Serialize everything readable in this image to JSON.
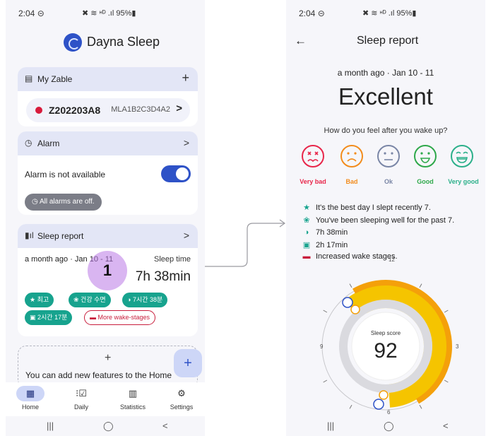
{
  "left": {
    "status": {
      "time": "2:04 ⊝",
      "icons": "✖ ≋ ᵸᴰ .ıl 95%▮"
    },
    "app_title": "Dayna Sleep",
    "zable": {
      "title": "My Zable",
      "add": "+",
      "device_id": "Z202203A8",
      "device_mac": "MLA1B2C3D4A2",
      "chevron": ">"
    },
    "alarm": {
      "title": "Alarm",
      "chevron": ">",
      "status": "Alarm is not available",
      "chip": "All alarms are off."
    },
    "sleep_report": {
      "title": "Sleep report",
      "chevron": ">",
      "when": "a month ago · Jan 10 - 11",
      "time_label": "Sleep time",
      "time_value": "7h 38min",
      "tags": [
        "최고",
        "건강 수면",
        "7시간 38분",
        "2시간 17분",
        "More wake-stages"
      ]
    },
    "touch_marker": "1",
    "add_feature": {
      "plus": "+",
      "text": "You can add new features to the Home"
    },
    "fab": "+",
    "nav": [
      {
        "label": "Home",
        "icon": "home-icon"
      },
      {
        "label": "Daily",
        "icon": "checklist-icon"
      },
      {
        "label": "Statistics",
        "icon": "chart-icon"
      },
      {
        "label": "Settings",
        "icon": "gear-icon"
      }
    ],
    "sysnav": {
      "recent": "|||",
      "home": "◯",
      "back": "<"
    }
  },
  "right": {
    "status": {
      "time": "2:04 ⊝",
      "icons": "✖ ≋ ᵸᴰ .ıl 95%▮"
    },
    "back": "←",
    "title": "Sleep report",
    "when": "a month ago · Jan 10 - 11",
    "rating": "Excellent",
    "question": "How do you feel after you wake up?",
    "moods": [
      {
        "label": "Very bad",
        "color": "#e8264a"
      },
      {
        "label": "Bad",
        "color": "#f28c1c"
      },
      {
        "label": "Ok",
        "color": "#7a86a6"
      },
      {
        "label": "Good",
        "color": "#2ea84a"
      },
      {
        "label": "Very good",
        "color": "#2cb08a"
      }
    ],
    "highlights": [
      {
        "text": "It's the best day I slept recently 7.",
        "icon": "star-icon"
      },
      {
        "text": "You've been sleeping well for the past 7.",
        "icon": "cluster-icon"
      },
      {
        "text": "7h 38min",
        "icon": "moon-icon"
      },
      {
        "text": "2h 17min",
        "icon": "zzz-icon"
      },
      {
        "text": "Increased wake stages.",
        "icon": "bed-icon"
      }
    ],
    "dial": {
      "labels": [
        "12",
        "3",
        "6",
        "9"
      ],
      "score_label": "Sleep score",
      "score": "92",
      "score_value": 92
    },
    "sysnav": {
      "recent": "|||",
      "home": "◯",
      "back": "<"
    }
  },
  "colors": {
    "primary": "#2e52c7",
    "teal": "#17a38e",
    "alert": "#c81e3c",
    "dial_yellow": "#f5c400",
    "dial_orange": "#f4a00a"
  }
}
